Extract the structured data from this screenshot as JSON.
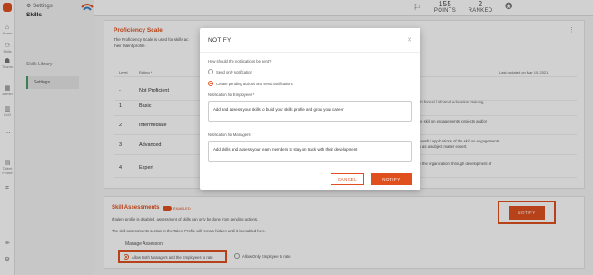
{
  "topbar": {
    "points_value": "155",
    "points_label": "POINTS",
    "ranked_value": "2",
    "ranked_label": "RANKED"
  },
  "rail": {
    "items": [
      "Home",
      "Skills",
      "Teams",
      "Admin",
      "CxO",
      "Talent Profile"
    ]
  },
  "sidebar": {
    "title": "Settings",
    "subtitle": "Skills",
    "items": [
      "Skills Library",
      "Settings"
    ]
  },
  "proficiency": {
    "title": "Proficiency Scale",
    "desc1": "The Proficiency Scale is used for skills ac",
    "desc2": "their talent profile.",
    "col_level": "Level",
    "col_rating": "Rating *",
    "updated": "Last updated on Mar 10, 2021",
    "rows": [
      {
        "level": "-",
        "name": "Not Proficient",
        "desc": ""
      },
      {
        "level": "1",
        "name": "Basic",
        "desc": "rough formal / informal education, training,"
      },
      {
        "level": "2",
        "name": "Intermediate",
        "desc": "of the skill on engagements, projects and/or"
      },
      {
        "level": "3",
        "name": "Advanced",
        "desc": "successful applications of the skill on engagements\nction as a subject matter expert."
      },
      {
        "level": "4",
        "name": "Expert",
        "desc": "tside the organization, through development of"
      }
    ]
  },
  "skill_assessments": {
    "title": "Skill Assessments",
    "toggle_label": "ENABLED",
    "text1": "If talent profile is disabled, assessment of skills can only be done from pending actions.",
    "text2": "The skill assessments section in the Talent Profile will remain hidden until it is enabled here.",
    "manage_label": "Manage Assessors",
    "option1": "Allow Both Managers and the Employees to rate",
    "option2": "Allow Only Employee to rate",
    "notify_button": "NOTIFY"
  },
  "modal": {
    "title": "NOTIFY",
    "question": "How should the notifications be sent?",
    "option1": "Send only notification",
    "option2": "Create pending actions and send notifications",
    "employees_label": "Notification for Employees *",
    "employees_value": "Add and assess your skills to build your skills profile and grow your career",
    "managers_label": "Notification for Managers *",
    "managers_value": "Add skills and assess your team members to stay on track with their development",
    "cancel": "CANCEL",
    "notify": "NOTIFY"
  },
  "colors": {
    "accent": "#e0501e",
    "active_bar": "#4a9d6a"
  }
}
